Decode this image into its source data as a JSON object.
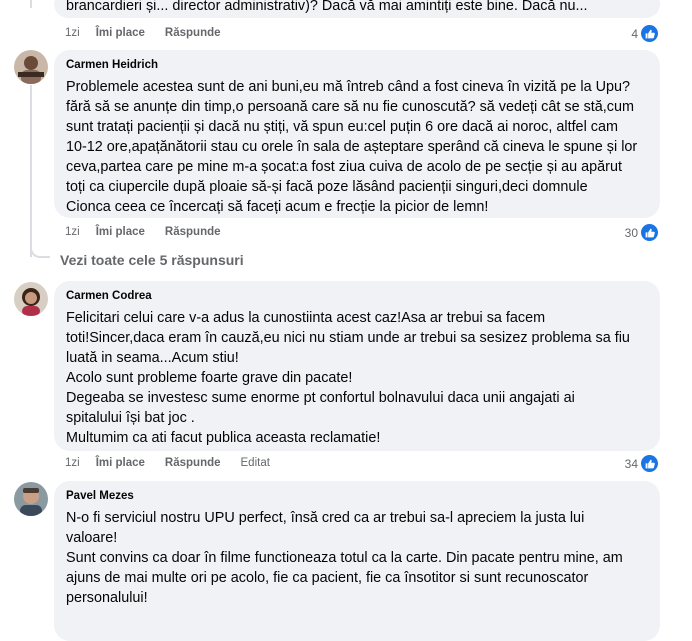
{
  "top_comment": {
    "text": "brancardieri și... director administrativ)? Dacă vă mai amintiți este bine. Dacă nu...",
    "time": "1zi",
    "like_label": "Îmi place",
    "reply_label": "Răspunde",
    "reaction_count": "4"
  },
  "comments": [
    {
      "author": "Carmen Heidrich",
      "lines": [
        "Problemele acestea sunt de ani buni,eu mă întreb când a fost cineva în vizită pe la Upu?",
        "fără să se anunțe din timp,o persoană care să nu fie cunoscută? să vedeți cât se stă,cum",
        "sunt tratați pacienții și dacă nu știți, vă spun eu:cel puțin 6 ore dacă ai noroc, altfel cam",
        "10-12 ore,apațănătorii stau cu orele în sala de așteptare sperând că cineva le spune și lor",
        "ceva,partea care pe mine m-a șocat:a fost ziua cuiva de acolo de pe secție și au apărut",
        "toți ca ciupercile după ploaie să-și facă poze lăsând pacienții singuri,deci domnule",
        "Cionca ceea ce încercați să faceți acum e frecție la picior de lemn!"
      ],
      "time": "1zi",
      "like_label": "Îmi place",
      "reply_label": "Răspunde",
      "reaction_count": "30"
    },
    {
      "author": "Carmen Codrea",
      "lines": [
        "Felicitari celui care v-a adus la cunostiinta acest caz!Asa ar trebui sa facem",
        "toti!Sincer,daca eram în cauză,eu nici nu stiam unde ar trebui sa sesizez problema sa fiu",
        "luată in seama...Acum stiu!",
        "Acolo sunt probleme foarte grave din pacate!",
        "Degeaba se investesc sume enorme pt confortul bolnavului daca unii angajati ai",
        "spitalului își bat joc .",
        "Multumim ca ati facut publica aceasta reclamatie!"
      ],
      "time": "1zi",
      "like_label": "Îmi place",
      "reply_label": "Răspunde",
      "edited_label": "Editat",
      "reaction_count": "34"
    },
    {
      "author": "Pavel Mezes",
      "lines": [
        "N-o fi serviciul nostru UPU perfect, însă cred ca ar trebui sa-l apreciem la justa lui",
        "valoare!",
        "Sunt convins ca doar în filme functioneaza totul ca la carte. Din pacate pentru mine, am",
        "ajuns de mai multe ori pe acolo, fie ca pacient, fie ca însotitor si sunt recunoscator",
        "personalului!"
      ]
    }
  ],
  "view_replies": "Vezi toate cele 5 răspunsuri",
  "colors": {
    "bubble": "#f0f2f5",
    "meta_text": "#65676b",
    "like_blue": "#1b74e4",
    "thread_line": "#dadde1"
  },
  "icons": [
    "like-icon",
    "avatar"
  ]
}
